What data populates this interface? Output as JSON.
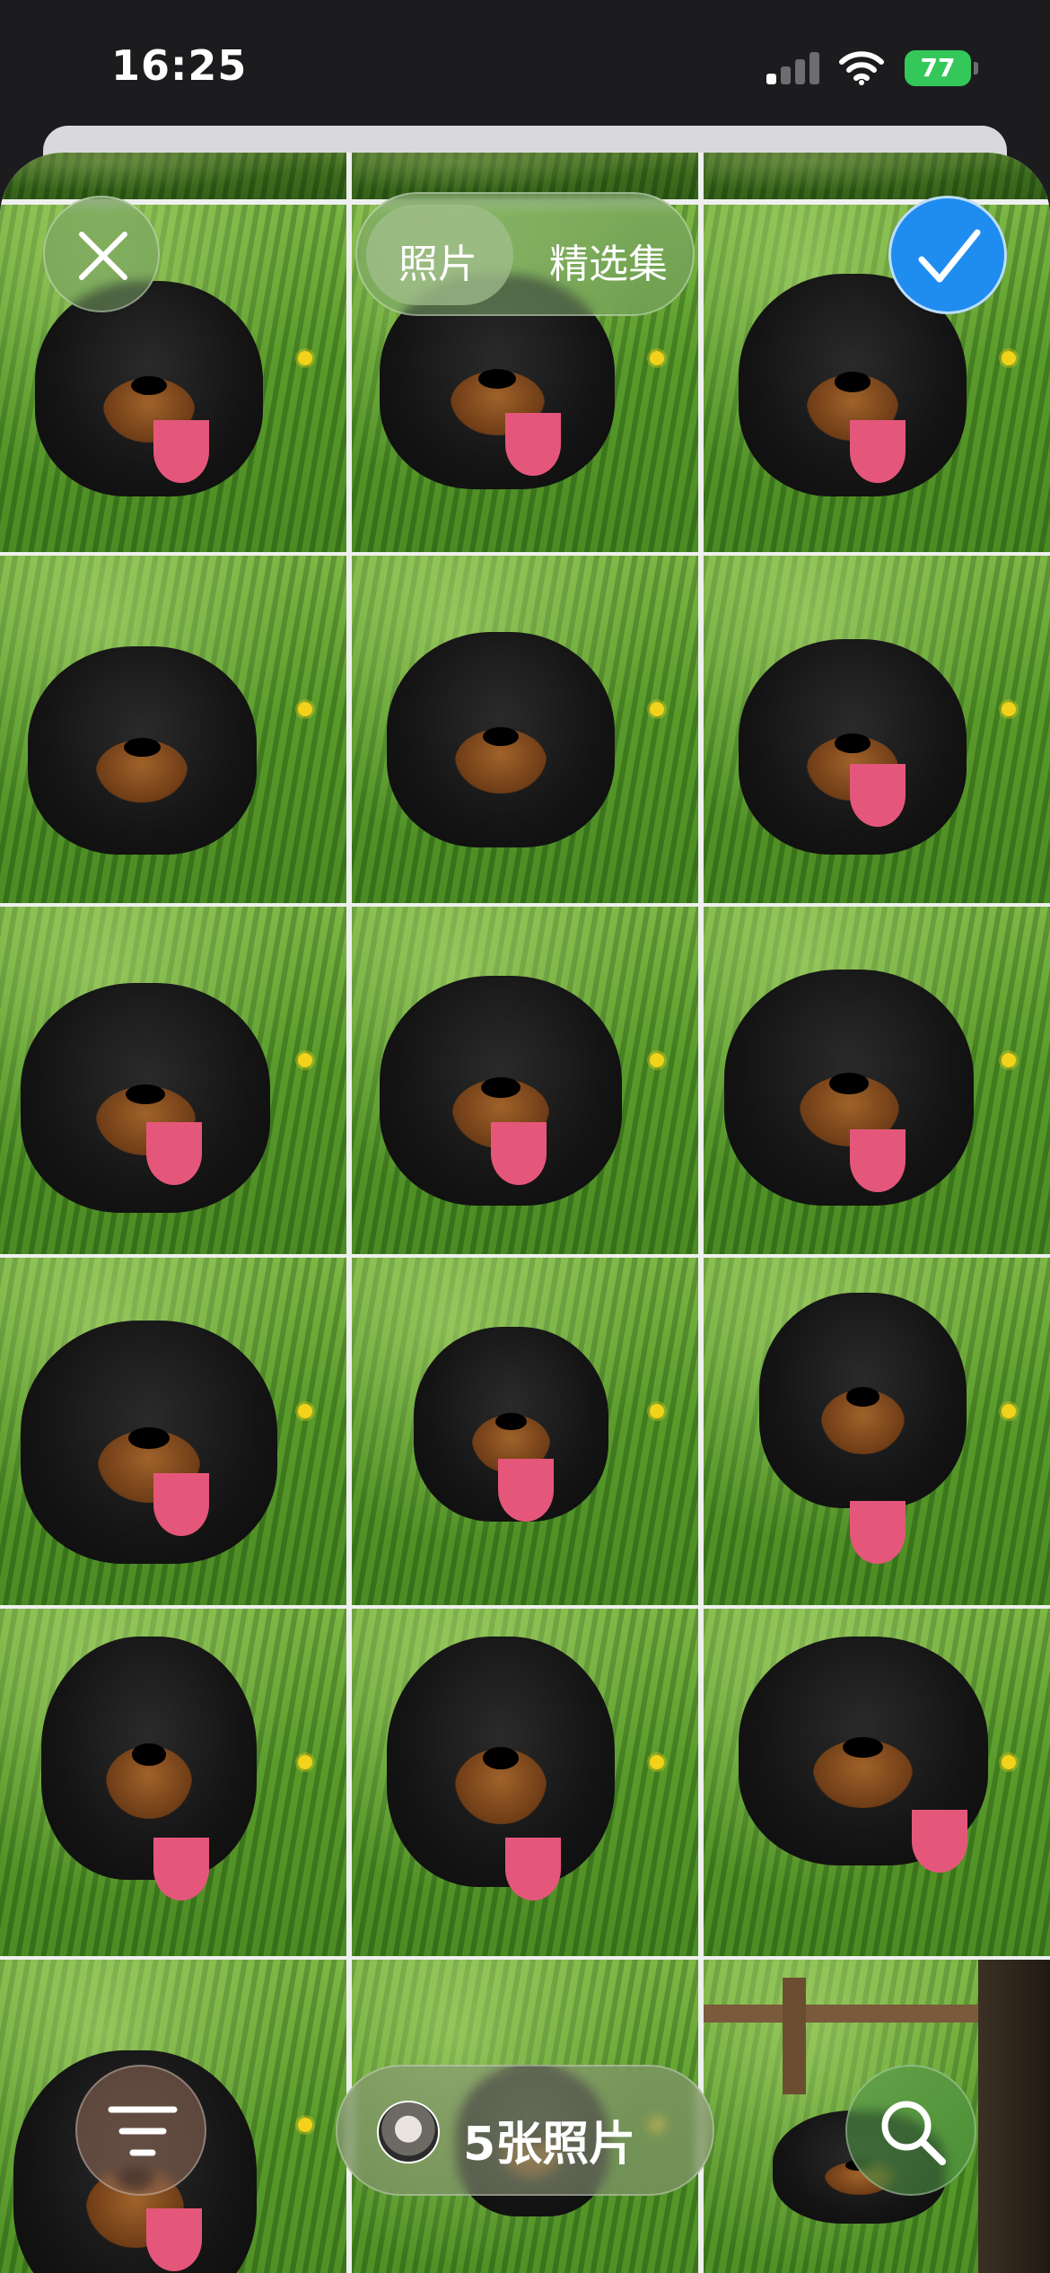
{
  "status_bar": {
    "time": "16:25",
    "battery": "77",
    "battery_color": "#34c759",
    "signal_icon": "cellular-signal-icon",
    "wifi_icon": "wifi-icon"
  },
  "header": {
    "close_icon": "close-icon",
    "segments": [
      {
        "label": "照片",
        "selected": true
      },
      {
        "label": "精选集",
        "selected": false
      }
    ],
    "confirm_icon": "checkmark-icon",
    "confirm_color": "#1f8cf0"
  },
  "grid": {
    "columns": 3,
    "rows": 6,
    "subject": "dog-photo",
    "photos": [
      {
        "name": "photo-1"
      },
      {
        "name": "photo-2"
      },
      {
        "name": "photo-3"
      },
      {
        "name": "photo-4"
      },
      {
        "name": "photo-5"
      },
      {
        "name": "photo-6"
      },
      {
        "name": "photo-7"
      },
      {
        "name": "photo-8"
      },
      {
        "name": "photo-9"
      },
      {
        "name": "photo-10"
      },
      {
        "name": "photo-11"
      },
      {
        "name": "photo-12"
      },
      {
        "name": "photo-13"
      },
      {
        "name": "photo-14"
      },
      {
        "name": "photo-15"
      },
      {
        "name": "photo-16"
      },
      {
        "name": "photo-17"
      },
      {
        "name": "photo-18"
      }
    ]
  },
  "footer": {
    "filter_icon": "filter-icon",
    "selection_count_label": "5张照片",
    "search_icon": "search-icon"
  }
}
